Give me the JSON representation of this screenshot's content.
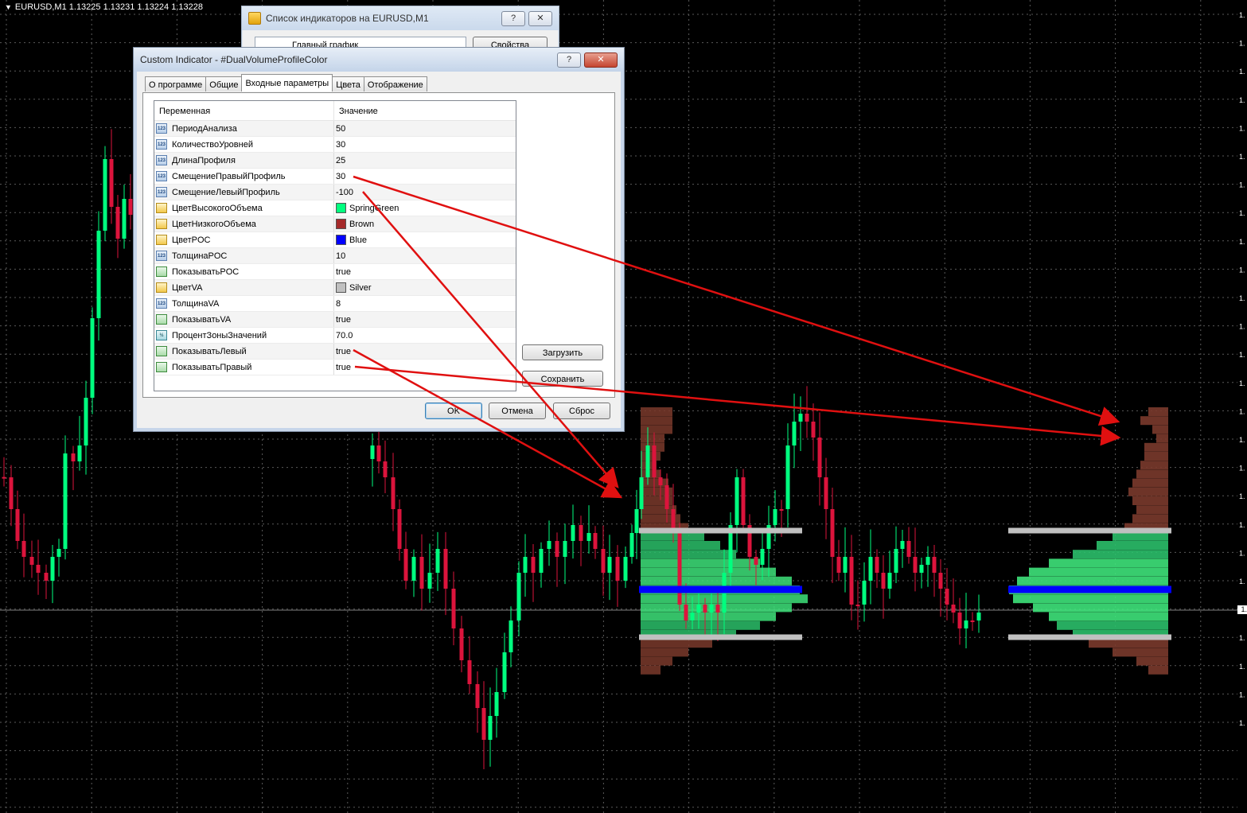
{
  "chart": {
    "symbol_title": "EURUSD,M1  1.13225 1.13231 1.13224 1.13228",
    "colors": {
      "background": "#000000",
      "bull": "#00ff7f",
      "bear": "#dc143c",
      "grid": "#5a5a5a",
      "poc": "#0000ff",
      "va": "#c0c0c0"
    },
    "axis_labels": [
      "1.",
      "1.",
      "1.",
      "1.",
      "1.",
      "1.",
      "1.",
      "1.",
      "1.",
      "1.",
      "1.",
      "1.",
      "1.",
      "1.",
      "1.",
      "1.",
      "1.",
      "1.",
      "1.",
      "1.",
      "1.",
      "1.",
      "1.",
      "1.",
      "1.",
      "1."
    ],
    "current_price_tag": "1."
  },
  "indicator_list_dialog": {
    "title": "Список индикаторов на EURUSD,M1",
    "help_label": "?",
    "close_label": "✕",
    "tree_item": "Главный график",
    "properties_button": "Свойства"
  },
  "dialog": {
    "title": "Custom Indicator - #DualVolumeProfileColor",
    "help_label": "?",
    "close_label": "✕",
    "tabs": [
      {
        "label": "О программе",
        "active": false
      },
      {
        "label": "Общие",
        "active": false
      },
      {
        "label": "Входные параметры",
        "active": true
      },
      {
        "label": "Цвета",
        "active": false
      },
      {
        "label": "Отображение",
        "active": false
      }
    ],
    "grid": {
      "header_variable": "Переменная",
      "header_value": "Значение",
      "rows": [
        {
          "name": "ПериодАнализа",
          "value": "50",
          "icon": "int-icon",
          "icon_text": "123"
        },
        {
          "name": "КоличествоУровней",
          "value": "30",
          "icon": "int-icon",
          "icon_text": "123"
        },
        {
          "name": "ДлинаПрофиля",
          "value": "25",
          "icon": "int-icon",
          "icon_text": "123"
        },
        {
          "name": "СмещениеПравыйПрофиль",
          "value": "30",
          "icon": "int-icon",
          "icon_text": "123"
        },
        {
          "name": "СмещениеЛевыйПрофиль",
          "value": "-100",
          "icon": "int-icon",
          "icon_text": "123"
        },
        {
          "name": "ЦветВысокогоОбъема",
          "value": "SpringGreen",
          "icon": "color-icon",
          "icon_text": "",
          "swatch": "#00ff7f"
        },
        {
          "name": "ЦветНизкогоОбъема",
          "value": "Brown",
          "icon": "color-icon",
          "icon_text": "",
          "swatch": "#a52a2a"
        },
        {
          "name": "ЦветPOC",
          "value": "Blue",
          "icon": "color-icon",
          "icon_text": "",
          "swatch": "#0000ff"
        },
        {
          "name": "ТолщинаPOC",
          "value": "10",
          "icon": "int-icon",
          "icon_text": "123"
        },
        {
          "name": "ПоказыватьPOC",
          "value": "true",
          "icon": "bool-icon",
          "icon_text": ""
        },
        {
          "name": "ЦветVA",
          "value": "Silver",
          "icon": "color-icon",
          "icon_text": "",
          "swatch": "#c0c0c0"
        },
        {
          "name": "ТолщинаVA",
          "value": "8",
          "icon": "int-icon",
          "icon_text": "123"
        },
        {
          "name": "ПоказыватьVA",
          "value": "true",
          "icon": "bool-icon",
          "icon_text": ""
        },
        {
          "name": "ПроцентЗоныЗначений",
          "value": "70.0",
          "icon": "double-icon",
          "icon_text": "½"
        },
        {
          "name": "ПоказыватьЛевый",
          "value": "true",
          "icon": "bool-icon",
          "icon_text": ""
        },
        {
          "name": "ПоказыватьПравый",
          "value": "true",
          "icon": "bool-icon",
          "icon_text": ""
        }
      ]
    },
    "load_button": "Загрузить",
    "save_button": "Сохранить",
    "ok_button": "OK",
    "cancel_button": "Отмена",
    "reset_button": "Сброс"
  }
}
